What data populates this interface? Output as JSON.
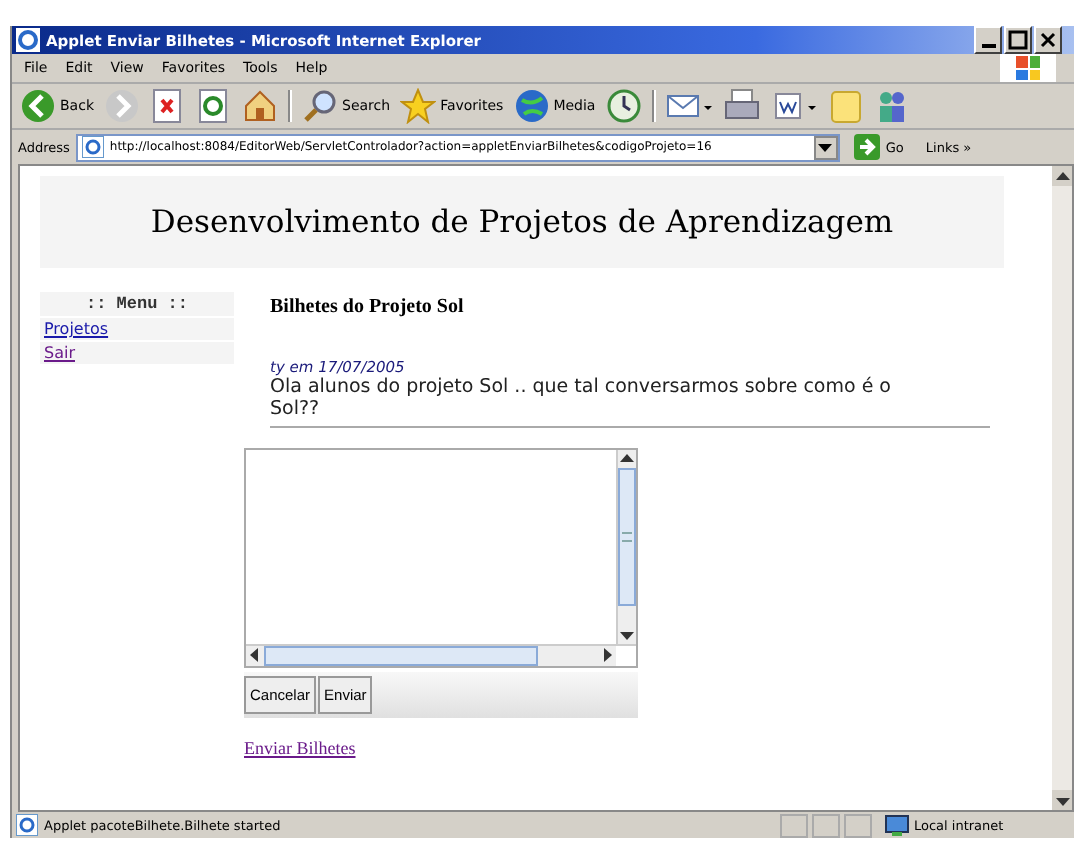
{
  "window": {
    "title": "Applet Enviar Bilhetes - Microsoft Internet Explorer"
  },
  "menu_bar": [
    "File",
    "Edit",
    "View",
    "Favorites",
    "Tools",
    "Help"
  ],
  "toolbar": [
    {
      "kind": "back",
      "label": "Back"
    },
    {
      "kind": "forward"
    },
    {
      "kind": "stop"
    },
    {
      "kind": "refresh"
    },
    {
      "kind": "home"
    },
    {
      "kind": "search",
      "label": "Search"
    },
    {
      "kind": "favorites",
      "label": "Favorites"
    },
    {
      "kind": "media",
      "label": "Media"
    },
    {
      "kind": "history"
    },
    {
      "kind": "mail"
    },
    {
      "kind": "print"
    },
    {
      "kind": "edit"
    },
    {
      "kind": "note"
    },
    {
      "kind": "messenger"
    }
  ],
  "address_bar": {
    "label": "Address",
    "url": "http://localhost:8084/EditorWeb/ServletControlador?action=appletEnviarBilhetes&codigoProjeto=16",
    "go": "Go",
    "links": "Links »"
  },
  "page": {
    "heading": "Desenvolvimento de Projetos de Aprendizagem",
    "side_menu": {
      "title": ":: Menu ::",
      "items": [
        {
          "label": "Projetos",
          "visited": false
        },
        {
          "label": "Sair",
          "visited": true
        }
      ]
    },
    "section_title": "Bilhetes do Projeto Sol",
    "posts": [
      {
        "byline": "ty em 17/07/2005",
        "text": "Ola alunos do projeto Sol .. que tal conversarmos sobre como é o Sol??"
      }
    ],
    "applet": {
      "buttons": [
        "Cancelar",
        "Enviar"
      ]
    },
    "link": "Enviar Bilhetes"
  },
  "status_bar": {
    "text": "Applet pacoteBilhete.Bilhete started",
    "zone": "Local intranet"
  }
}
